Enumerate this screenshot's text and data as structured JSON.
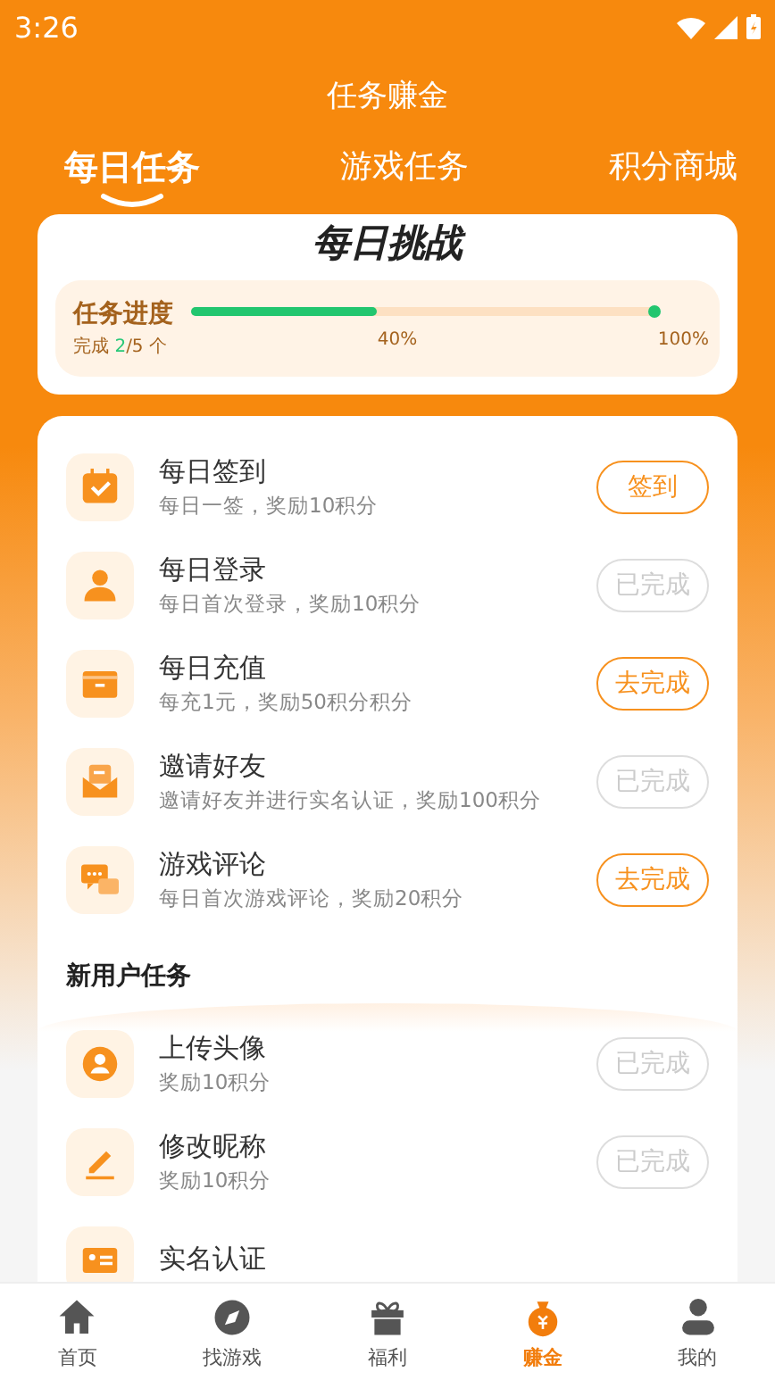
{
  "status_bar": {
    "time": "3:26"
  },
  "header": {
    "title": "任务赚金"
  },
  "tabs": [
    {
      "label": "每日任务",
      "selected": true
    },
    {
      "label": "游戏任务",
      "selected": false
    },
    {
      "label": "积分商城",
      "selected": false
    }
  ],
  "challenge": {
    "title": "每日挑战",
    "progress_label": "任务进度",
    "done_prefix": "完成",
    "done_count": "2",
    "done_total": "/5 个",
    "level": 0.4,
    "mid_label": "40%",
    "end_label": "100%"
  },
  "daily_tasks": [
    {
      "title": "每日签到",
      "desc": "每日一签，奖励10积分",
      "button": "签到",
      "done": false
    },
    {
      "title": "每日登录",
      "desc": "每日首次登录，奖励10积分",
      "button": "已完成",
      "done": true
    },
    {
      "title": "每日充值",
      "desc": "每充1元，奖励50积分积分",
      "button": "去完成",
      "done": false
    },
    {
      "title": "邀请好友",
      "desc": "邀请好友并进行实名认证，奖励100积分",
      "button": "已完成",
      "done": true
    },
    {
      "title": "游戏评论",
      "desc": "每日首次游戏评论，奖励20积分",
      "button": "去完成",
      "done": false
    }
  ],
  "new_user_section": {
    "title": "新用户任务"
  },
  "new_user_tasks": [
    {
      "title": "上传头像",
      "desc": "奖励10积分",
      "button": "已完成",
      "done": true
    },
    {
      "title": "修改昵称",
      "desc": "奖励10积分",
      "button": "已完成",
      "done": true
    },
    {
      "title": "实名认证"
    }
  ],
  "bottom_nav": [
    {
      "label": "首页",
      "selected": false
    },
    {
      "label": "找游戏",
      "selected": false
    },
    {
      "label": "福利",
      "selected": false
    },
    {
      "label": "赚金",
      "selected": true
    },
    {
      "label": "我的",
      "selected": false
    }
  ]
}
